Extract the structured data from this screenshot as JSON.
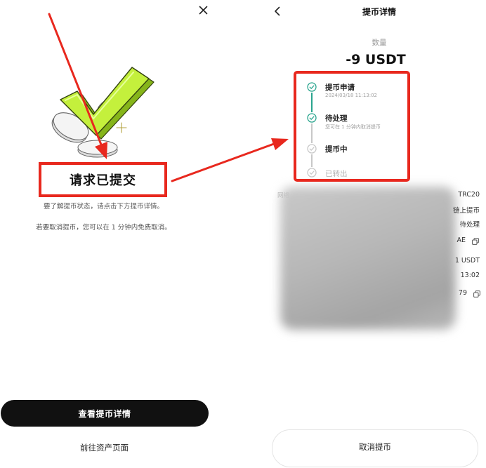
{
  "left": {
    "close_icon": "close-icon",
    "illustration_icon": "green-checkmark-with-coins",
    "title": "请求已提交",
    "hint_status": "要了解提币状态，请点击下方提币详情。",
    "hint_cancel": "若要取消提币，您可以在 1 分钟内免费取消。",
    "view_details_button": "查看提币详情",
    "assets_link": "前往资产页面"
  },
  "right": {
    "back_icon": "chevron-left-icon",
    "title": "提币详情",
    "amount_label": "数量",
    "amount": "-9 USDT",
    "timeline": [
      {
        "title": "提币申请",
        "sub": "2024/03/18 11:13:02",
        "completed": true
      },
      {
        "title": "待处理",
        "sub": "您可在 1 分钟内取消提币",
        "completed": true
      },
      {
        "title": "提币中",
        "completed": false
      },
      {
        "title": "已转出",
        "completed": false
      }
    ],
    "details": [
      {
        "label": "网络",
        "value": "TRC20"
      },
      {
        "value": "链上提币"
      },
      {
        "value": "待处理"
      },
      {
        "value": "AE",
        "icon": "copy-icon"
      },
      {
        "value": "1 USDT"
      },
      {
        "value": "13:02"
      },
      {
        "value": "79",
        "icon": "copy-icon"
      }
    ],
    "cancel_button": "取消提币"
  },
  "colors": {
    "accent": "#2aa58e",
    "pending": "#c8c8c8",
    "check_green": "#c4f03c",
    "primary_button_bg": "#111111",
    "annotation": "#e8281e"
  }
}
